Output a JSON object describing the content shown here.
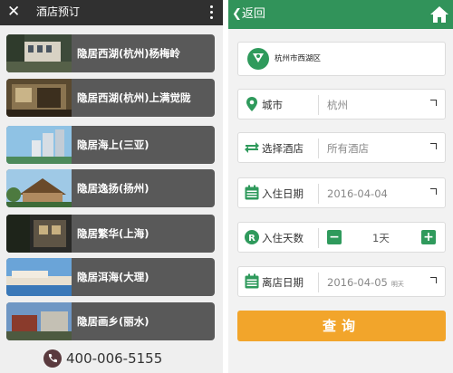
{
  "left": {
    "title": "酒店预订",
    "hotels": [
      {
        "name": "隐居西湖(杭州)杨梅岭"
      },
      {
        "name": "隐居西湖(杭州)上满觉陇"
      },
      {
        "name": "隐居海上(三亚)"
      },
      {
        "name": "隐居逸扬(扬州)"
      },
      {
        "name": "隐居繁华(上海)"
      },
      {
        "name": "隐居洱海(大理)"
      },
      {
        "name": "隐居画乡(丽水)"
      }
    ],
    "phone": "400-006-5155"
  },
  "right": {
    "back_label": "返回",
    "location_label": "杭州市西湖区",
    "city": {
      "label": "城市",
      "value": "杭州"
    },
    "hotel": {
      "label": "选择酒店",
      "value": "所有酒店"
    },
    "checkin": {
      "label": "入住日期",
      "value": "2016-04-04"
    },
    "nights": {
      "label": "入住天数",
      "value": "1天",
      "minus": "−",
      "plus": "+"
    },
    "checkout": {
      "label": "离店日期",
      "value": "2016-04-05",
      "sub": "明天"
    },
    "query_label": "查询"
  },
  "colors": {
    "green": "#31935a",
    "orange": "#f2a52b",
    "dark_bar": "#303030",
    "hotel_item_bg": "#595959"
  }
}
